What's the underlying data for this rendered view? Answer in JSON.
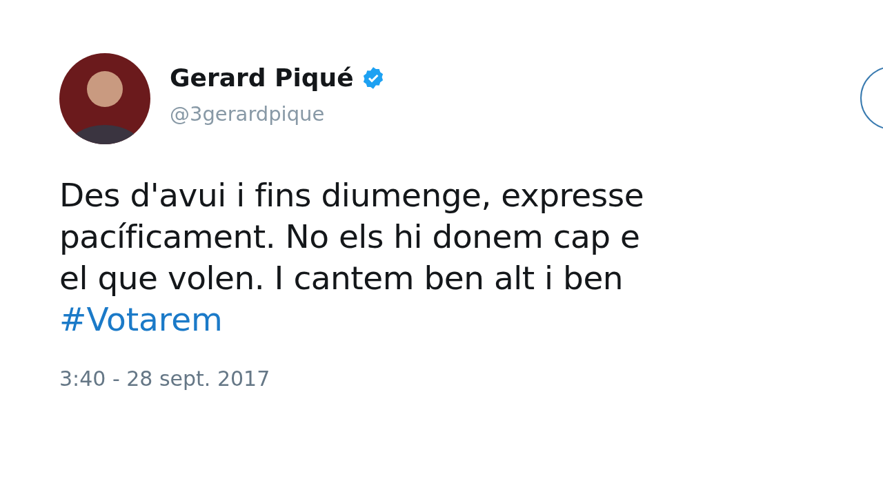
{
  "author": {
    "name": "Gerard Piqué",
    "verified": true,
    "handle": "@3gerardpique"
  },
  "tweet": {
    "lines": [
      "Des d'avui i fins diumenge, expresse",
      "pacíficament. No els hi donem cap e",
      "el que volen. I cantem ben alt i ben"
    ],
    "hashtag": "#Votarem"
  },
  "timestamp": "3:40 - 28 sept. 2017"
}
